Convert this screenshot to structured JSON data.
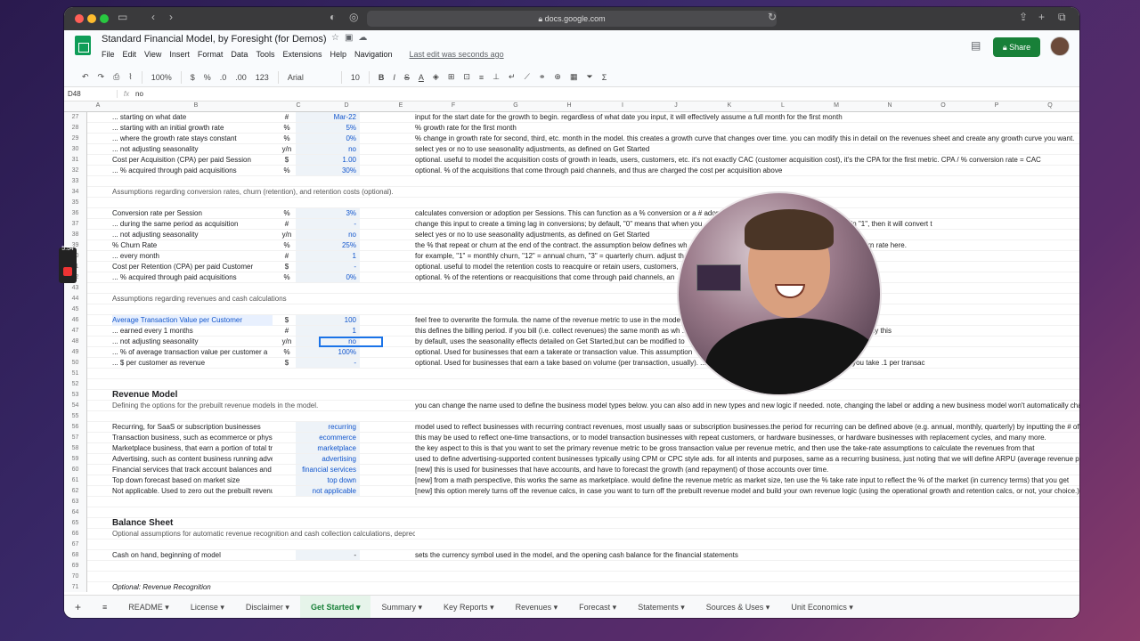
{
  "browser": {
    "url": "docs.google.com"
  },
  "doc": {
    "title": "Standard Financial Model, by Foresight (for Demos)",
    "last_edit": "Last edit was seconds ago",
    "share": "Share",
    "menu": [
      "File",
      "Edit",
      "View",
      "Insert",
      "Format",
      "Data",
      "Tools",
      "Extensions",
      "Help",
      "Navigation"
    ]
  },
  "toolbar": {
    "zoom": "100%",
    "currency": "$",
    "percent": "%",
    "dec1": ".0",
    "dec2": ".00",
    "format": "123",
    "font": "Arial",
    "size": "10"
  },
  "formula": {
    "cell": "D48",
    "value": "no"
  },
  "columns": [
    "A",
    "B",
    "C",
    "D",
    "E",
    "F",
    "G",
    "H",
    "I",
    "J",
    "K",
    "L",
    "M",
    "N",
    "O",
    "P",
    "Q"
  ],
  "rows": [
    {
      "n": "27",
      "b": "... starting on what date",
      "c": "#",
      "d": "Mar-22",
      "e": "input for the start date for the growth to begin. regardless of what date you input, it will effectively assume a full month for the first month"
    },
    {
      "n": "28",
      "b": "... starting with an initial growth rate",
      "c": "%",
      "d": "5%",
      "e": "% growth rate for the first month"
    },
    {
      "n": "29",
      "b": "... where the growth rate stays constant",
      "c": "%",
      "d": "0%",
      "e": "% change in growth rate for second, third, etc. month in the model. this creates a growth curve that changes over time. you can modify this in detail on the revenues sheet and create any growth curve you want."
    },
    {
      "n": "30",
      "b": "... not adjusting seasonality",
      "c": "y/n",
      "d": "no",
      "e": "select yes or no to use seasonality adjustments, as defined on Get Started"
    },
    {
      "n": "31",
      "b": "Cost per Acquisition (CPA) per paid Session",
      "c": "$",
      "d": "1.00",
      "e": "optional. useful to model the acquisition costs of growth in leads, users, customers, etc. it's not exactly CAC (customer acquisition cost), it's the CPA for the first metric. CPA / % conversion rate = CAC"
    },
    {
      "n": "32",
      "b": "... % acquired through paid acquisitions",
      "c": "%",
      "d": "30%",
      "e": "optional. % of the acquisitions that come through paid channels, and thus are charged the cost per acquisition above"
    },
    {
      "n": "33",
      "b": "",
      "c": "",
      "d": "",
      "e": ""
    },
    {
      "n": "34",
      "b": "Assumptions regarding conversion rates, churn (retention), and retention costs (optional).",
      "c": "",
      "d": "",
      "e": "",
      "cls": "sub"
    },
    {
      "n": "35",
      "b": "",
      "c": "",
      "d": "",
      "e": ""
    },
    {
      "n": "36",
      "b": "Conversion rate per Session",
      "c": "%",
      "d": "3%",
      "e": "calculates conversion or adoption per Sessions. This can function as a % conversion or a # adopted"
    },
    {
      "n": "37",
      "b": "... during the same period as acquisition",
      "c": "#",
      "d": "-",
      "e": "change this input to create a timing lag in conversions; by default, \"0\" means that when you ... etric in the same period (month). if you type in \"1\", then it will convert t"
    },
    {
      "n": "38",
      "b": "... not adjusting seasonality",
      "c": "y/n",
      "d": "no",
      "e": "select yes or no to use seasonality adjustments, as defined on Get Started"
    },
    {
      "n": "39",
      "b": "% Churn Rate",
      "c": "%",
      "d": "25%",
      "e": "the % that repeat or churn at the end of the contract. the assumption below defines wh ... \"1\" in the row below, you'll want to input a monthly churn rate here."
    },
    {
      "n": "40",
      "b": "... every month",
      "c": "#",
      "d": "1",
      "e": "for example, \"1\" = monthly churn, \"12\" = annual churn, \"3\" = quarterly churn. adjust th"
    },
    {
      "n": "41",
      "b": "Cost per Retention (CPA) per paid Customer",
      "c": "$",
      "d": "-",
      "e": "optional. useful to model the retention costs to reacquire or retain users, customers,"
    },
    {
      "n": "42",
      "b": "... % acquired through paid acquisitions",
      "c": "%",
      "d": "0%",
      "e": "optional. % of the retentions or reacquisitions that come through paid channels, an"
    },
    {
      "n": "43",
      "b": "",
      "c": "",
      "d": "",
      "e": ""
    },
    {
      "n": "44",
      "b": "Assumptions regarding revenues and cash calculations",
      "c": "",
      "d": "",
      "e": "",
      "cls": "sub"
    },
    {
      "n": "45",
      "b": "",
      "c": "",
      "d": "",
      "e": ""
    },
    {
      "n": "46",
      "b": "Average Transaction Value per Customer",
      "c": "$",
      "d": "100",
      "e": "feel free to overwrite the formula. the name of the revenue metric to use in the mode ... ining the revenues in the model",
      "cls": "blue"
    },
    {
      "n": "47",
      "b": "... earned every 1 months",
      "c": "#",
      "d": "1",
      "e": "this defines the billing period. if you bill (i.e. collect revenues) the same month as wh ... ance, enter in the number of months billed at a time. usually this"
    },
    {
      "n": "48",
      "b": "... not adjusting seasonality",
      "c": "y/n",
      "d": "no",
      "e": "by default, uses the seasonality effects detailed on Get Started,but can be modified to"
    },
    {
      "n": "49",
      "b": "... % of average transaction value per customer a",
      "c": "%",
      "d": "100%",
      "e": "optional. Used for businesses that earn a takerate or transaction value. This assumption"
    },
    {
      "n": "50",
      "b": "... $ per customer as revenue",
      "c": "$",
      "d": "-",
      "e": "optional. Used for businesses that earn a take based on volume (per transaction, usually). ... transaction\", so if you have a structure where you take .1 per transac"
    },
    {
      "n": "51",
      "b": "",
      "c": "",
      "d": "",
      "e": ""
    },
    {
      "n": "52",
      "b": "",
      "c": "",
      "d": "",
      "e": ""
    },
    {
      "n": "53",
      "b": "Revenue Model",
      "c": "",
      "d": "",
      "e": "",
      "cls": "sect"
    },
    {
      "n": "54",
      "b": "Defining the options for the prebuilt revenue models in the model.",
      "c": "",
      "d": "",
      "e": "you can change the name used to define the business model types below. you can also add in new types and new logic if needed. note, changing the label or adding a new business model won't automatically chang",
      "cls": "sub"
    },
    {
      "n": "55",
      "b": "",
      "c": "",
      "d": "",
      "e": ""
    },
    {
      "n": "56",
      "b": "Recurring, for SaaS or subscription businesses",
      "c": "",
      "d": "recurring",
      "e": "model used to reflect businesses with recurring contract revenues, most usually saas or subscription businesses.the period for recurring can be defined above (e.g. annual, monthly, quarterly) by inputting the # of mo"
    },
    {
      "n": "57",
      "b": "Transaction business, such as ecommerce or physical comi",
      "c": "",
      "d": "ecommerce",
      "e": "this may be used to reflect one-time transactions, or to model transaction businesses with repeat customers, or hardware businesses, or hardware businesses with replacement cycles, and many more."
    },
    {
      "n": "58",
      "b": "Marketplace business, that earn a portion of total transactio",
      "c": "",
      "d": "marketplace",
      "e": "the key aspect to this is that you want to set the primary revenue metric to be gross transaction value per revenue metric, and then use the take-rate assumptions to calculate the revenues from that"
    },
    {
      "n": "59",
      "b": "Advertising, such as content business running advertiseme",
      "c": "",
      "d": "advertising",
      "e": "used to define advertising-supported content businesses typically using CPM or CPC style ads. for all intents and purposes, same as a recurring business, just noting that we will define ARPU (average revenue per u"
    },
    {
      "n": "60",
      "b": "Financial services that track account balances and earn rev",
      "c": "",
      "d": "financial services",
      "e": "[new] this is used for businesses that have accounts, and have to forecast the growth (and repayment) of those accounts over time."
    },
    {
      "n": "61",
      "b": "Top down forecast based on market size",
      "c": "",
      "d": "top down",
      "e": "[new] from a math perspective, this works the same as marketplace. would define the revenue metric as market size, ten use the % take rate input to reflect the % of the market (in currency terms) that you get"
    },
    {
      "n": "62",
      "b": "Not applicable. Used to zero out the prebuilt revenue calcs",
      "c": "",
      "d": "not applicable",
      "e": "[new] this option merely turns off the revenue calcs, in case you want to turn off the prebuilt revenue model and build your own revenue logic (using the operational growth and retention calcs, or not, your choice.)"
    },
    {
      "n": "63",
      "b": "",
      "c": "",
      "d": "",
      "e": ""
    },
    {
      "n": "64",
      "b": "",
      "c": "",
      "d": "",
      "e": ""
    },
    {
      "n": "65",
      "b": "Balance Sheet",
      "c": "",
      "d": "",
      "e": "",
      "cls": "sect"
    },
    {
      "n": "66",
      "b": "Optional assumptions for automatic revenue recognition and cash collection calculations, depreciation, corporate taxes, and VAT",
      "c": "",
      "d": "",
      "e": "",
      "cls": "sub"
    },
    {
      "n": "67",
      "b": "",
      "c": "",
      "d": "",
      "e": ""
    },
    {
      "n": "68",
      "b": "Cash on hand, beginning of model",
      "c": "",
      "d": "-",
      "e": "sets the currency symbol used in the model, and the opening cash balance for the financial statements"
    },
    {
      "n": "69",
      "b": "",
      "c": "",
      "d": "",
      "e": ""
    },
    {
      "n": "70",
      "b": "",
      "c": "",
      "d": "",
      "e": ""
    },
    {
      "n": "71",
      "b": "Optional: Revenue Recognition",
      "c": "",
      "d": "",
      "e": "",
      "cls": "ital"
    }
  ],
  "tabs": [
    "README",
    "License",
    "Disclaimer",
    "Get Started",
    "Summary",
    "Key Reports",
    "Revenues",
    "Forecast",
    "Statements",
    "Sources & Uses",
    "Unit Economics"
  ],
  "active_tab": "Get Started",
  "recorder": {
    "time": "5:54"
  }
}
